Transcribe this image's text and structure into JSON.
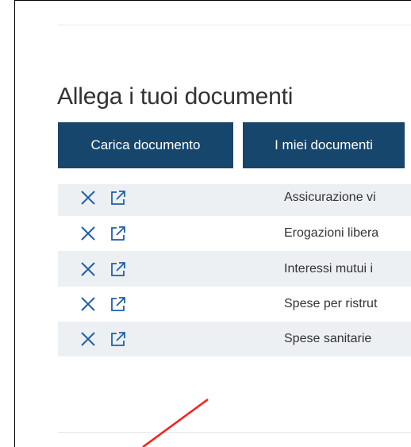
{
  "section": {
    "title": "Allega i tuoi documenti"
  },
  "tabs": [
    {
      "label": "Carica documento"
    },
    {
      "label": "I miei documenti"
    }
  ],
  "documents": [
    {
      "label": "Assicurazione vi"
    },
    {
      "label": "Erogazioni libera"
    },
    {
      "label": "Interessi mutui i"
    },
    {
      "label": "Spese per ristrut"
    },
    {
      "label": "Spese sanitarie"
    }
  ],
  "icons": {
    "remove": "close-icon",
    "open": "external-link-icon",
    "accent_color": "#1f5fa9"
  },
  "colors": {
    "tab_background": "#17466d",
    "row_alt_background": "#ecf0f3",
    "annotation_line": "#ff1a1a"
  }
}
